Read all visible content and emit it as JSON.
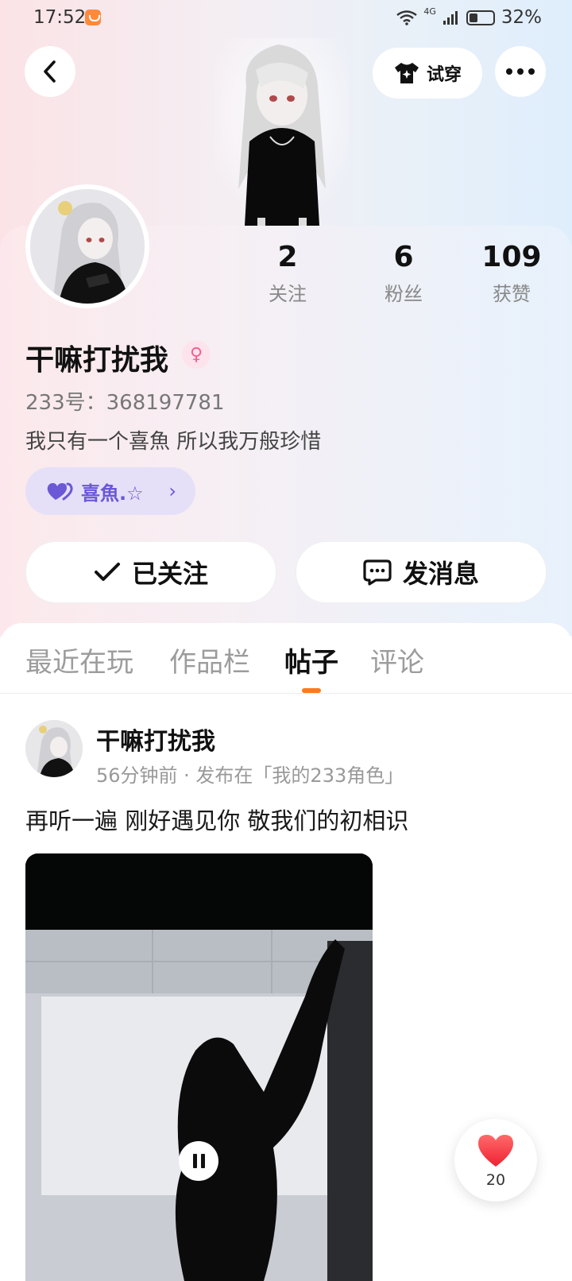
{
  "status_bar": {
    "time": "17:52",
    "network_label": "4G",
    "battery_percent": "32%",
    "battery_level": 0.32
  },
  "header": {
    "back_icon": "chevron-left-icon",
    "try_on_label": "试穿",
    "try_on_icon": "tshirt-sparkle-icon",
    "more_icon": "more-dots-icon"
  },
  "profile": {
    "stats": [
      {
        "value": "2",
        "label": "关注"
      },
      {
        "value": "6",
        "label": "粉丝"
      },
      {
        "value": "109",
        "label": "获赞"
      }
    ],
    "nickname": "干嘛打扰我",
    "gender_icon": "female-symbol-icon",
    "uid": "233号：368197781",
    "bio": "我只有一个喜魚 所以我万般珍惜",
    "tag": {
      "label": "喜魚.☆",
      "icon": "heart-couple-icon"
    },
    "follow_button": "已关注",
    "message_button": "发消息"
  },
  "tabs": [
    {
      "label": "最近在玩",
      "active": false
    },
    {
      "label": "作品栏",
      "active": false
    },
    {
      "label": "帖子",
      "active": true
    },
    {
      "label": "评论",
      "active": false
    }
  ],
  "post": {
    "author": "干嘛打扰我",
    "meta": "56分钟前 · 发布在「我的233角色」",
    "text": "再听一遍 刚好遇见你 敬我们的初相识"
  },
  "like_float": {
    "count": "20"
  },
  "colors": {
    "accent_orange": "#ff7a1a",
    "tag_purple": "#6a58d6",
    "like_red": "#ff3b3b"
  }
}
